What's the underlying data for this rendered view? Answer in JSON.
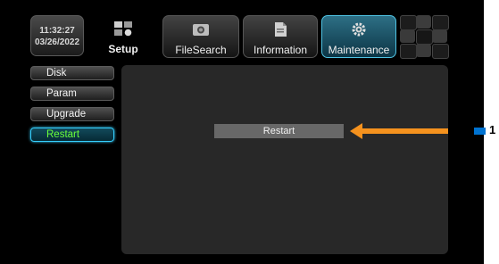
{
  "clock": {
    "time": "11:32:27",
    "date": "03/26/2022"
  },
  "tabs": [
    {
      "label": "Setup",
      "icon": "setup-grid-icon"
    },
    {
      "label": "FileSearch",
      "icon": "camera-icon"
    },
    {
      "label": "Information",
      "icon": "document-icon"
    },
    {
      "label": "Maintenance",
      "icon": "gear-icon",
      "active": true
    }
  ],
  "sidebar": {
    "items": [
      {
        "label": "Disk"
      },
      {
        "label": "Param"
      },
      {
        "label": "Upgrade"
      },
      {
        "label": "Restart",
        "active": true
      }
    ]
  },
  "main": {
    "restart_button": "Restart"
  },
  "callout": {
    "number": "1"
  },
  "colors": {
    "accent": "#36d0ff",
    "active_text": "#6aff3a",
    "arrow": "#f5921e",
    "callout_line": "#0073d1"
  }
}
